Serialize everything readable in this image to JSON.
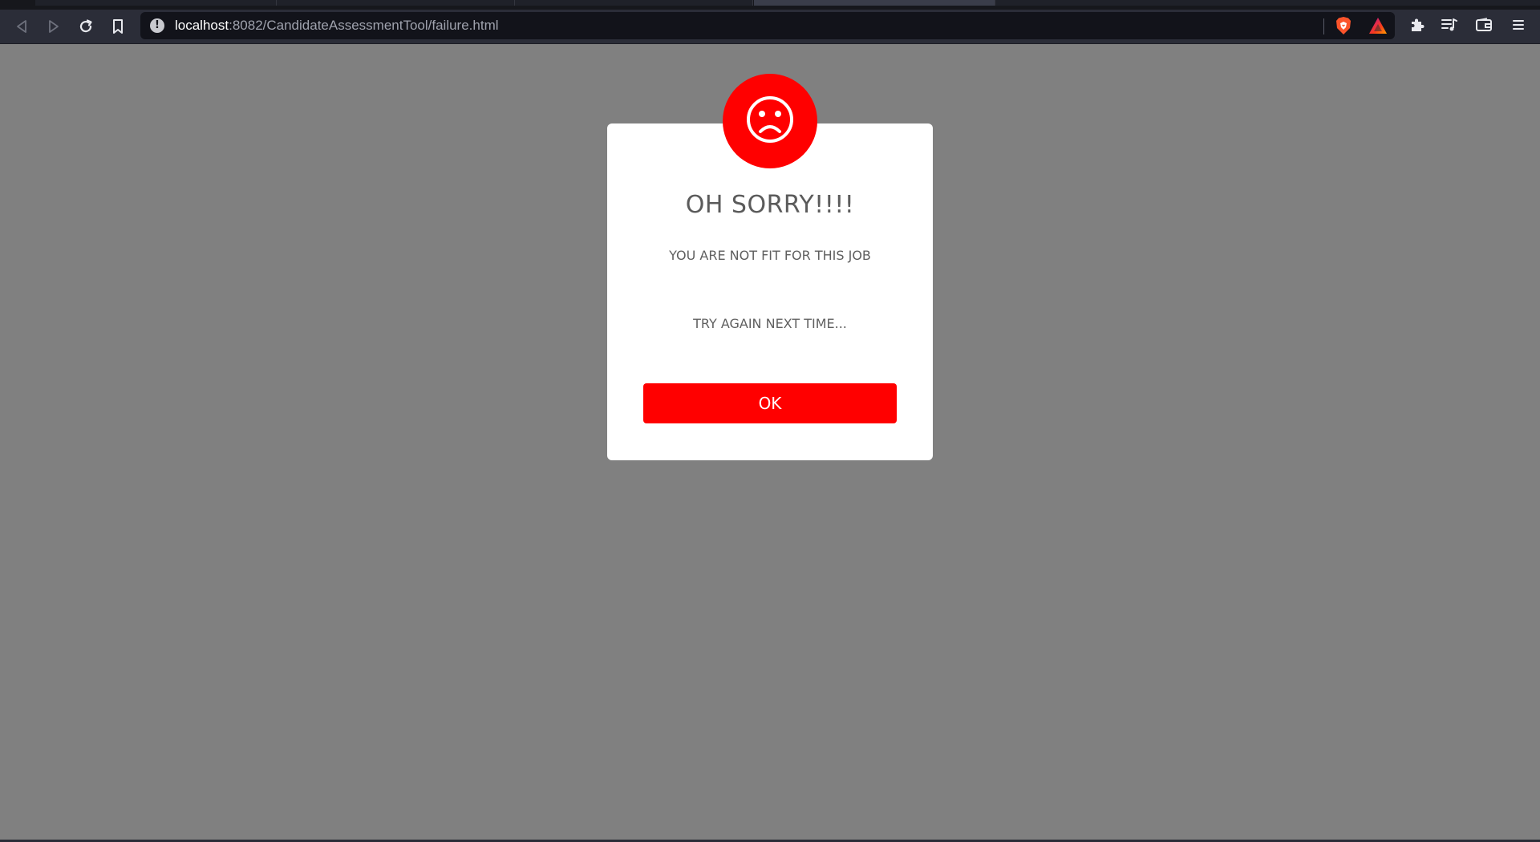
{
  "browser": {
    "url_host": "localhost",
    "url_path": ":8082/CandidateAssessmentTool/failure.html",
    "icons": {
      "back": "back-arrow-icon",
      "forward": "forward-arrow-icon",
      "reload": "reload-icon",
      "bookmark": "bookmark-icon",
      "site_info": "info-icon",
      "shields": "brave-shields-icon",
      "rewards": "brave-rewards-icon",
      "extensions": "puzzle-piece-icon",
      "playlist": "playlist-icon",
      "wallet": "wallet-icon",
      "menu": "hamburger-menu-icon"
    }
  },
  "modal": {
    "icon": "sad-face-icon",
    "title": "OH SORRY!!!!",
    "message": "YOU ARE NOT FIT FOR THIS JOB",
    "submessage": "TRY AGAIN NEXT TIME...",
    "ok_label": "OK"
  },
  "colors": {
    "accent": "#ff0000",
    "backdrop": "#808080",
    "modal_bg": "#ffffff",
    "text": "#5b5b5b"
  }
}
